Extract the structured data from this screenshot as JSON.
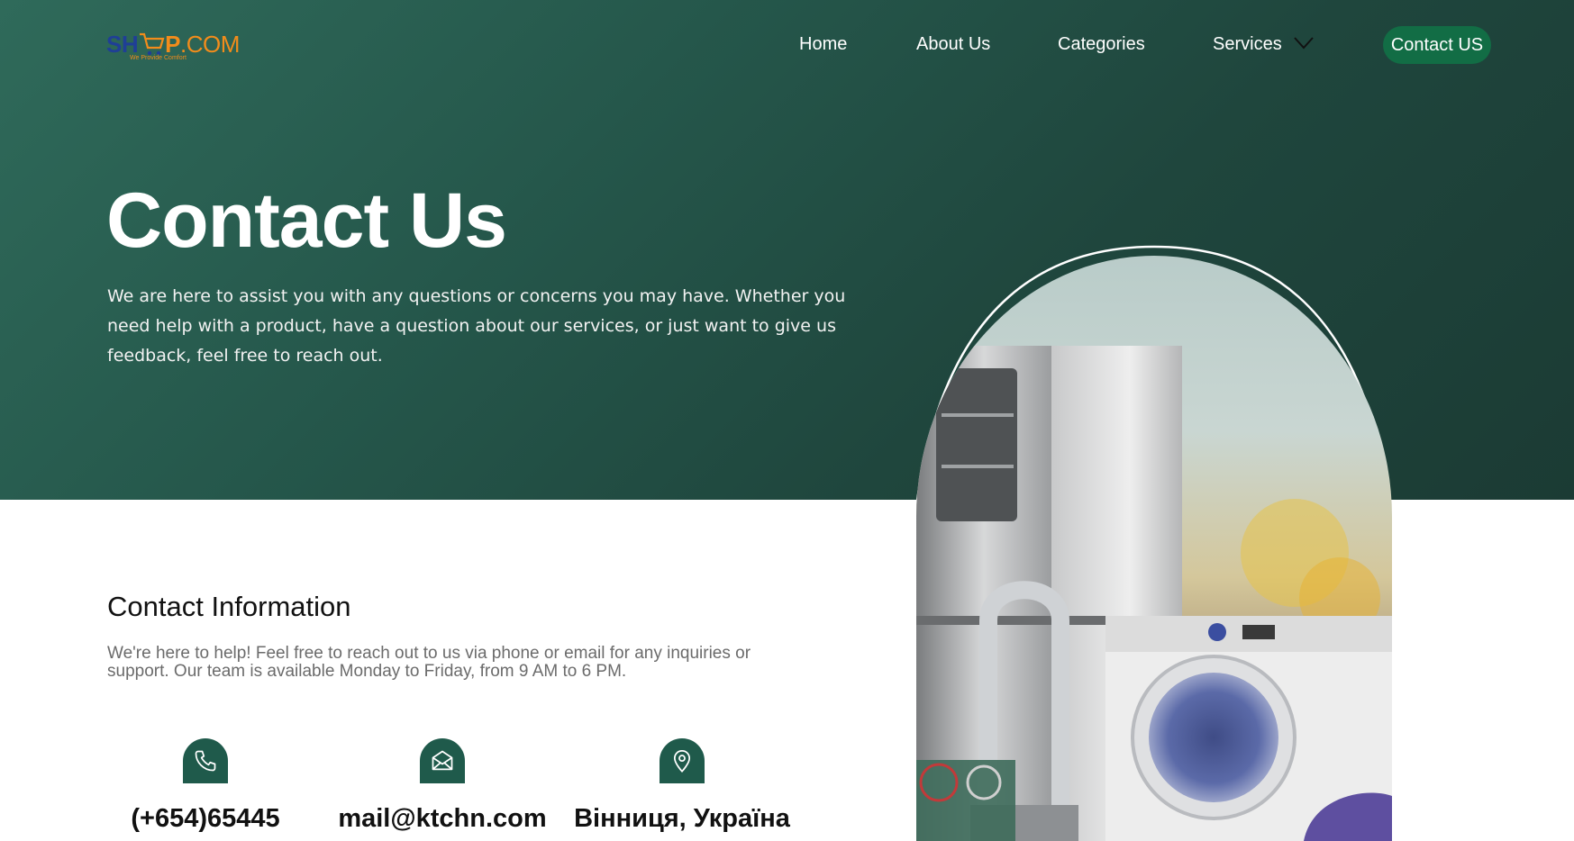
{
  "logo": {
    "sh": "SH",
    "cart": "🛒",
    "p": "P",
    "com": ".COM",
    "tagline": "We Provide Comfort"
  },
  "nav": {
    "links": [
      "Home",
      "About Us",
      "Categories",
      "Services"
    ],
    "services_dropdown_icon": "chevron-down-icon",
    "cta": "Contact US"
  },
  "hero": {
    "title": "Contact Us",
    "description": "We are here to assist you with any questions or concerns you may have. Whether you need help with a product, have a question about our services, or just want to give us feedback, feel free to reach out."
  },
  "contact": {
    "heading": "Contact Information",
    "description": "We're here to help! Feel free to reach out to us via phone or email for any inquiries or support. Our team is available Monday to Friday, from 9 AM to 6 PM.",
    "items": [
      {
        "icon": "phone-icon",
        "value": "(+654)65445"
      },
      {
        "icon": "mail-icon",
        "value": "mail@ktchn.com"
      },
      {
        "icon": "location-pin-icon",
        "value": "Вінниця, Україна"
      }
    ]
  },
  "colors": {
    "hero_bg": "#25574b",
    "cta_bg": "#126d45",
    "icon_bg": "#1f5a4b",
    "logo_blue": "#1f3f96",
    "logo_orange": "#f28c1b"
  }
}
